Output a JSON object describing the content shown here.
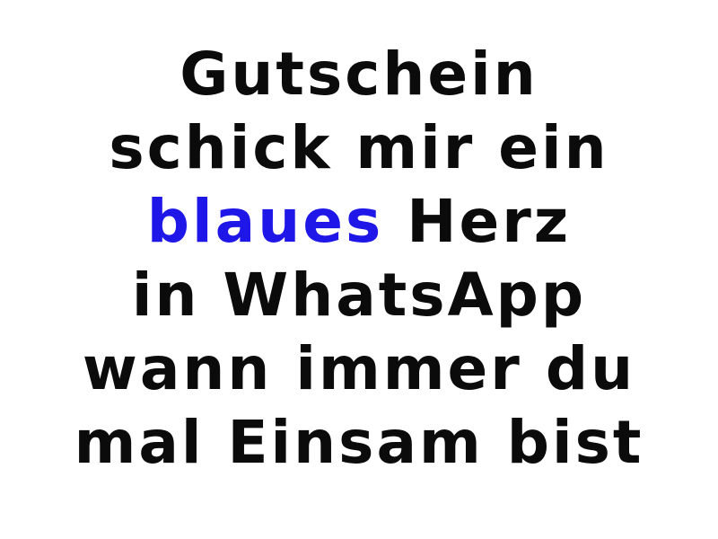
{
  "lines": [
    "Gutschein",
    "schick mir ein",
    "Herz",
    "in WhatsApp",
    "wann immer du",
    "mal Einsam bist"
  ],
  "highlight": {
    "word": "blaues",
    "color": "#1f17e8"
  },
  "text_color": "#0b0b0b",
  "background_color": "#ffffff"
}
